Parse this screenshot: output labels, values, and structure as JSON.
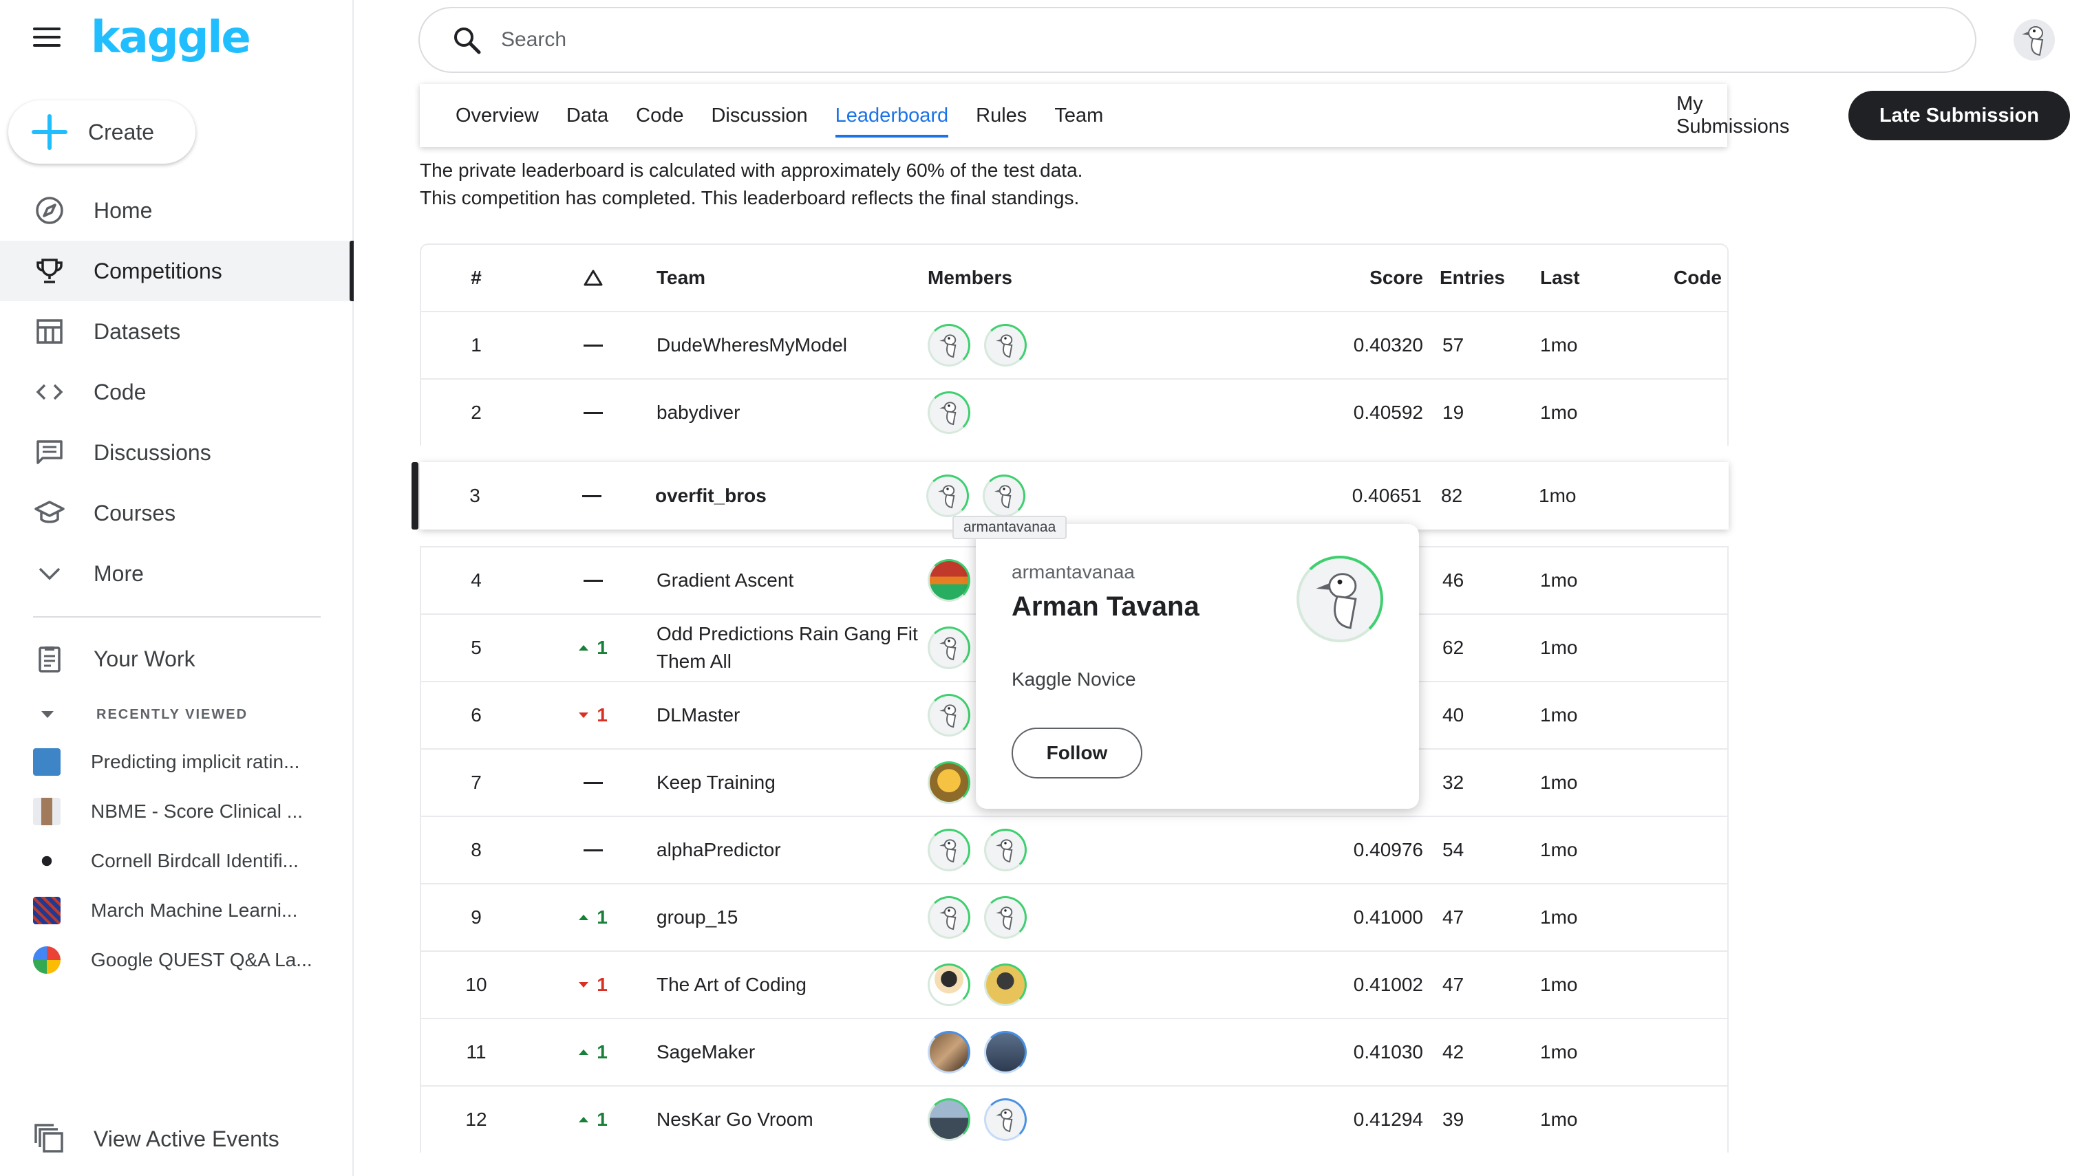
{
  "app": {
    "logo": "kaggle",
    "create_label": "Create"
  },
  "sidebar": {
    "items": [
      {
        "label": "Home",
        "icon": "compass-icon",
        "active": false
      },
      {
        "label": "Competitions",
        "icon": "trophy-icon",
        "active": true
      },
      {
        "label": "Datasets",
        "icon": "table-icon",
        "active": false
      },
      {
        "label": "Code",
        "icon": "code-icon",
        "active": false
      },
      {
        "label": "Discussions",
        "icon": "comments-icon",
        "active": false
      },
      {
        "label": "Courses",
        "icon": "school-icon",
        "active": false
      },
      {
        "label": "More",
        "icon": "chevron-down-icon",
        "active": false
      }
    ],
    "your_work": "Your Work",
    "recently_viewed_title": "RECENTLY VIEWED",
    "recent": [
      {
        "label": "Predicting implicit ratin...",
        "color": "#3d85c6"
      },
      {
        "label": "NBME - Score Clinical ...",
        "color": "#a07a5a"
      },
      {
        "label": "Cornell Birdcall Identifi...",
        "color": "#202124"
      },
      {
        "label": "March Machine Learni...",
        "color": "#1f3a93"
      },
      {
        "label": "Google QUEST Q&A La...",
        "color": "#ea4335"
      }
    ],
    "events_label": "View Active Events"
  },
  "search": {
    "placeholder": "Search",
    "value": ""
  },
  "tabs": [
    "Overview",
    "Data",
    "Code",
    "Discussion",
    "Leaderboard",
    "Rules",
    "Team"
  ],
  "active_tab": "Leaderboard",
  "my_submissions": "My Submissions",
  "late_submission": "Late Submission",
  "notes": [
    "The private leaderboard is calculated with approximately 60% of the test data.",
    "This competition has completed. This leaderboard reflects the final standings."
  ],
  "table": {
    "headers": {
      "rank": "#",
      "delta": "△",
      "team": "Team",
      "members": "Members",
      "score": "Score",
      "entries": "Entries",
      "last": "Last",
      "code": "Code"
    },
    "rows": [
      {
        "rank": "1",
        "delta": "—",
        "team": "DudeWheresMyModel",
        "members": [
          "goose",
          "goose"
        ],
        "score": "0.40320",
        "entries": "57",
        "last": "1mo"
      },
      {
        "rank": "2",
        "delta": "—",
        "team": "babydiver",
        "members": [
          "goose"
        ],
        "score": "0.40592",
        "entries": "19",
        "last": "1mo"
      },
      {
        "rank": "3",
        "delta": "—",
        "team": "overfit_bros",
        "members": [
          "goose",
          "goose"
        ],
        "score": "0.40651",
        "entries": "82",
        "last": "1mo",
        "highlight": true
      },
      {
        "rank": "4",
        "delta": "—",
        "team": "Gradient Ascent",
        "members": [
          "photo1"
        ],
        "score": "",
        "entries": "46",
        "last": "1mo"
      },
      {
        "rank": "5",
        "delta": "up",
        "delta_val": "1",
        "team": "Odd Predictions Rain Gang Fit Them All",
        "members": [
          "goose"
        ],
        "score": "",
        "entries": "62",
        "last": "1mo"
      },
      {
        "rank": "6",
        "delta": "down",
        "delta_val": "1",
        "team": "DLMaster",
        "members": [
          "goose"
        ],
        "score": "",
        "entries": "40",
        "last": "1mo"
      },
      {
        "rank": "7",
        "delta": "—",
        "team": "Keep Training",
        "members": [
          "photo2"
        ],
        "score": "",
        "entries": "32",
        "last": "1mo"
      },
      {
        "rank": "8",
        "delta": "—",
        "team": "alphaPredictor",
        "members": [
          "goose",
          "goose"
        ],
        "score": "0.40976",
        "entries": "54",
        "last": "1mo"
      },
      {
        "rank": "9",
        "delta": "up",
        "delta_val": "1",
        "team": "group_15",
        "members": [
          "goose",
          "goose"
        ],
        "score": "0.41000",
        "entries": "47",
        "last": "1mo"
      },
      {
        "rank": "10",
        "delta": "down",
        "delta_val": "1",
        "team": "The Art of Coding",
        "members": [
          "photo3",
          "photo4"
        ],
        "score": "0.41002",
        "entries": "47",
        "last": "1mo"
      },
      {
        "rank": "11",
        "delta": "up",
        "delta_val": "1",
        "team": "SageMaker",
        "members": [
          "photo5",
          "photo6"
        ],
        "score": "0.41030",
        "entries": "42",
        "last": "1mo"
      },
      {
        "rank": "12",
        "delta": "up",
        "delta_val": "1",
        "team": "NesKar Go Vroom",
        "members": [
          "photo7",
          "gooseB"
        ],
        "score": "0.41294",
        "entries": "39",
        "last": "1mo"
      }
    ]
  },
  "popup": {
    "tooltip": "armantavanaa",
    "username": "armantavanaa",
    "fullname": "Arman Tavana",
    "tier": "Kaggle Novice",
    "follow": "Follow"
  }
}
